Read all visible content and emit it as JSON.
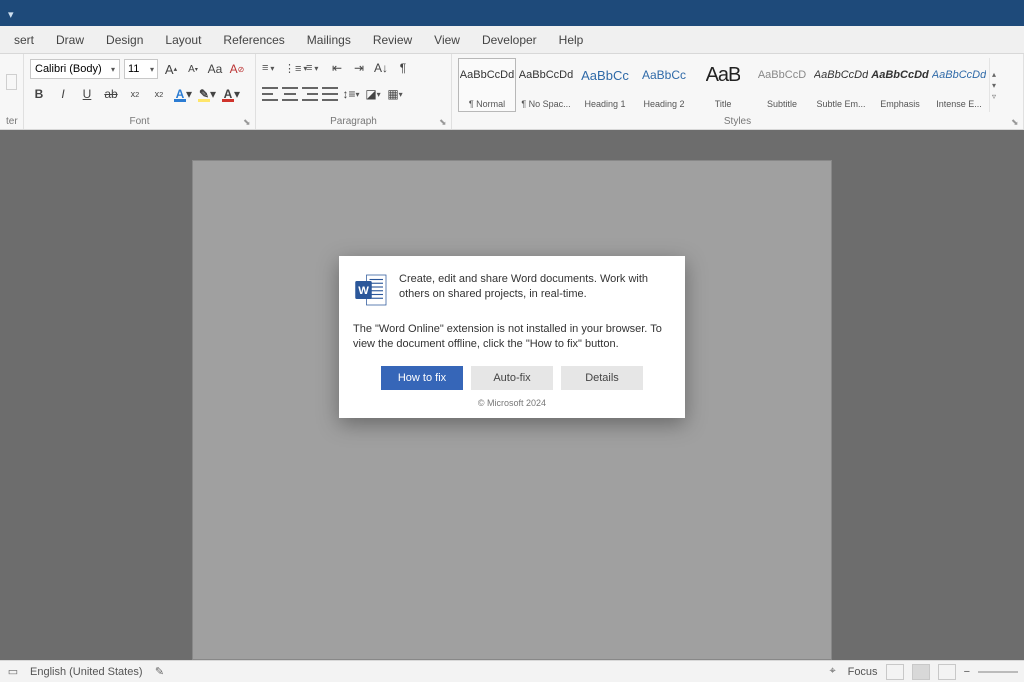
{
  "menubar": [
    "sert",
    "Draw",
    "Design",
    "Layout",
    "References",
    "Mailings",
    "Review",
    "View",
    "Developer",
    "Help"
  ],
  "left_small": {
    "top": "sert",
    "bottom": "ter"
  },
  "font": {
    "name": "Calibri (Body)",
    "size": "11",
    "label": "Font",
    "increase": "A↑",
    "decrease": "A↓",
    "changecase": "Aa",
    "clearfmt": "A⦸",
    "bold": "B",
    "italic": "I",
    "underline": "U",
    "strike": "ab",
    "subscript": "x₂",
    "superscript": "x²",
    "texteffects": "A",
    "highlight": "A",
    "fontcolor": "A"
  },
  "para": {
    "label": "Paragraph",
    "pilcrow": "¶"
  },
  "styles": {
    "label": "Styles",
    "sample": "AaBbCcDd",
    "sampleShort": "AaBbCc",
    "sampleTitle": "AaB",
    "sampleSub": "AaBbCcD",
    "items": [
      {
        "name": "¶ Normal"
      },
      {
        "name": "¶ No Spac..."
      },
      {
        "name": "Heading 1"
      },
      {
        "name": "Heading 2"
      },
      {
        "name": "Title"
      },
      {
        "name": "Subtitle"
      },
      {
        "name": "Subtle Em..."
      },
      {
        "name": "Emphasis"
      },
      {
        "name": "Intense E..."
      }
    ]
  },
  "dialog": {
    "line1": "Create, edit and share Word documents. Work with others on shared projects, in real-time.",
    "line2": "The \"Word Online\" extension is not installed in your browser. To view the document offline, click the \"How to fix\" button.",
    "btn_fix": "How to fix",
    "btn_auto": "Auto-fix",
    "btn_details": "Details",
    "copyright": "© Microsoft 2024"
  },
  "status": {
    "lang": "English (United States)",
    "focus": "Focus",
    "zoom_minus": "−"
  }
}
